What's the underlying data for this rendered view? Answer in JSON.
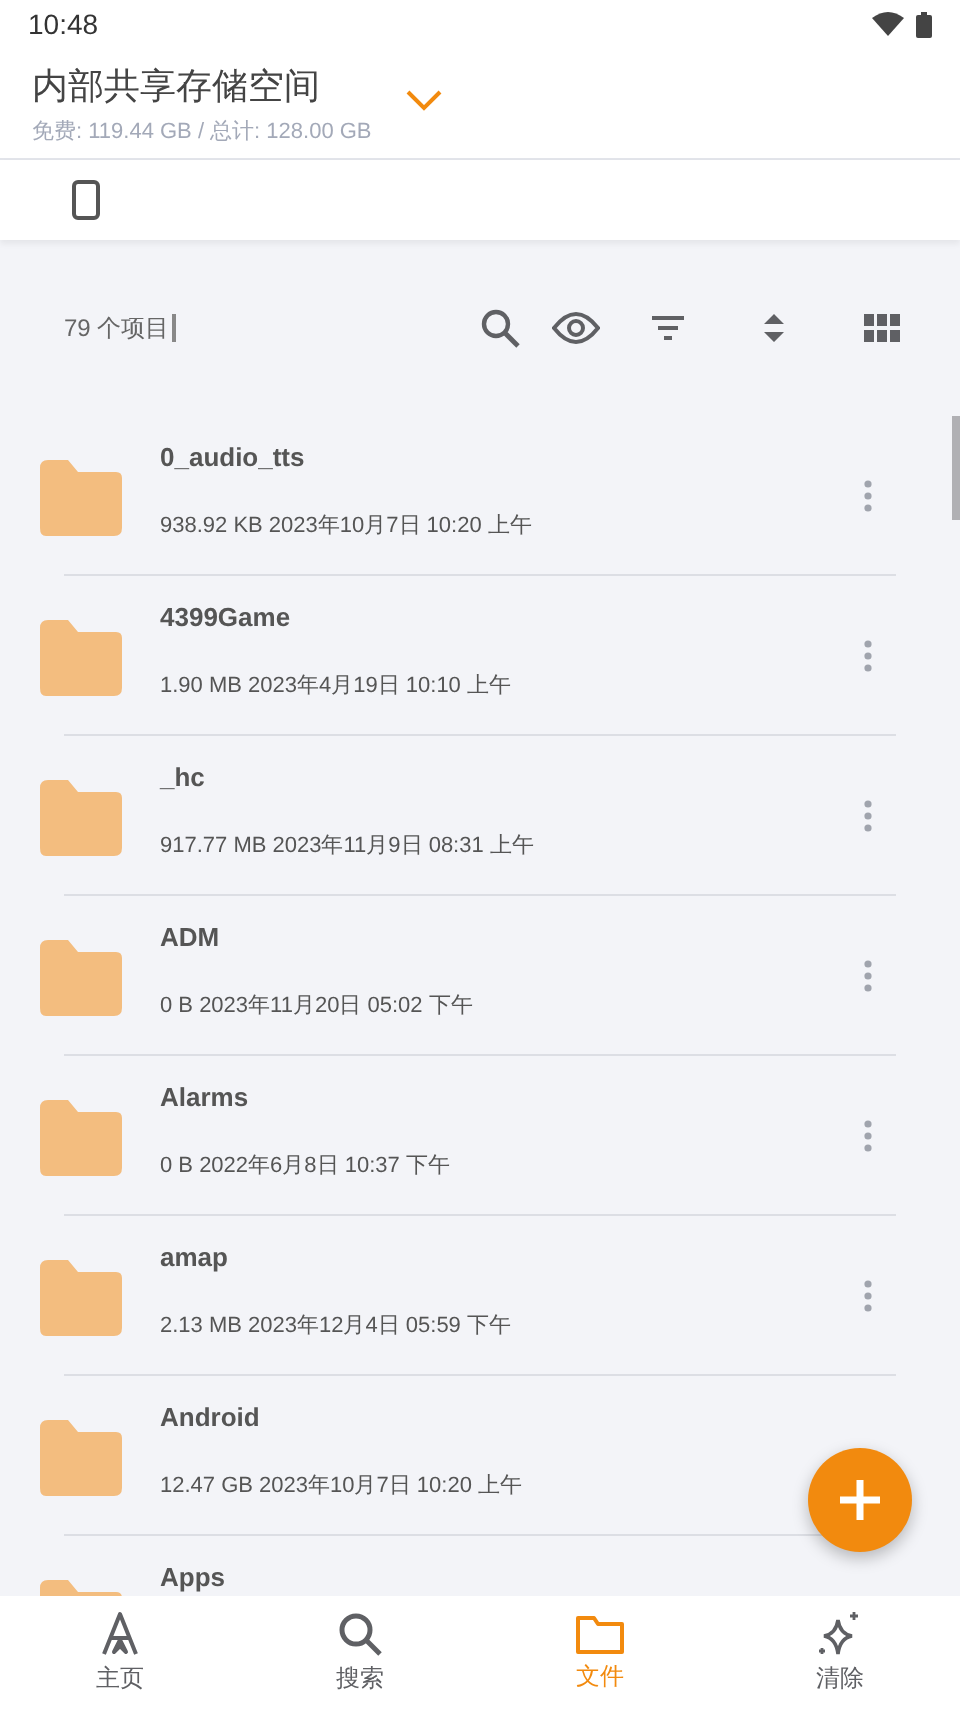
{
  "status_bar": {
    "time": "10:48"
  },
  "header": {
    "title": "内部共享存储空间",
    "subtitle": "免费: 119.44 GB / 总计: 128.00 GB"
  },
  "toolbar": {
    "count": "79 个项目"
  },
  "files": [
    {
      "name": "0_audio_tts",
      "meta": "938.92 KB 2023年10月7日 10:20 上午",
      "menu": true
    },
    {
      "name": "4399Game",
      "meta": "1.90 MB 2023年4月19日 10:10 上午",
      "menu": true
    },
    {
      "name": "_hc",
      "meta": "917.77 MB 2023年11月9日 08:31 上午",
      "menu": true
    },
    {
      "name": "ADM",
      "meta": "0 B 2023年11月20日 05:02 下午",
      "menu": true
    },
    {
      "name": "Alarms",
      "meta": "0 B 2022年6月8日 10:37 下午",
      "menu": true
    },
    {
      "name": "amap",
      "meta": "2.13 MB 2023年12月4日 05:59 下午",
      "menu": true
    },
    {
      "name": "Android",
      "meta": "12.47 GB 2023年10月7日 10:20 上午",
      "menu": false
    },
    {
      "name": "Apps",
      "menu": false
    }
  ],
  "nav": [
    {
      "label": "主页",
      "kind": "home",
      "selected": false
    },
    {
      "label": "搜索",
      "kind": "search",
      "selected": false
    },
    {
      "label": "文件",
      "kind": "files",
      "selected": true
    },
    {
      "label": "清除",
      "kind": "clean",
      "selected": false
    }
  ]
}
